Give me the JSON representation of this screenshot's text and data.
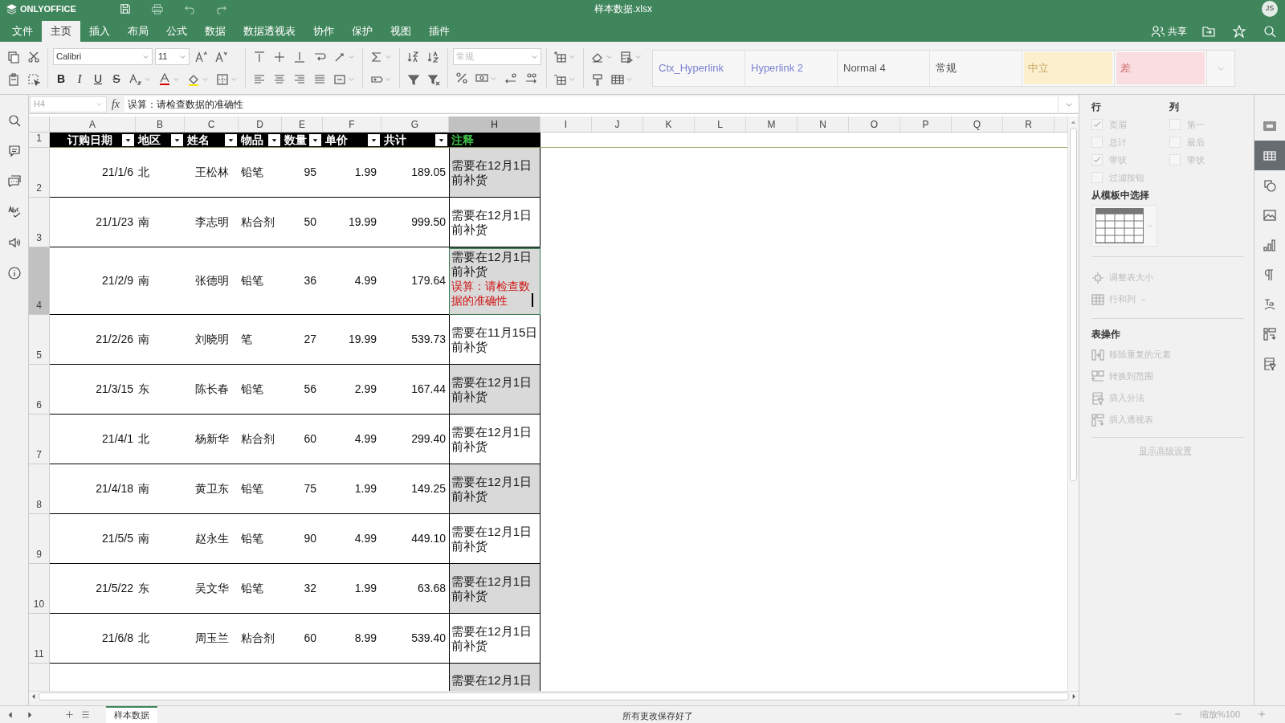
{
  "app": {
    "logo": "ONLYOFFICE",
    "title": "样本数据.xlsx",
    "avatar": "JS",
    "share": "共享"
  },
  "menu": [
    {
      "label": "文件",
      "selected": false
    },
    {
      "label": "主页",
      "selected": true
    },
    {
      "label": "插入",
      "selected": false
    },
    {
      "label": "布局",
      "selected": false
    },
    {
      "label": "公式",
      "selected": false
    },
    {
      "label": "数据",
      "selected": false
    },
    {
      "label": "数据透视表",
      "selected": false
    },
    {
      "label": "协作",
      "selected": false
    },
    {
      "label": "保护",
      "selected": false
    },
    {
      "label": "视图",
      "selected": false
    },
    {
      "label": "插件",
      "selected": false
    }
  ],
  "toolbar": {
    "font": "Calibri",
    "size": "11",
    "number_format": "常规",
    "bold": "B",
    "italic": "I",
    "underline": "U",
    "strike": "S"
  },
  "styles": [
    {
      "label": "Ctx_Hyperlink",
      "kind": "link"
    },
    {
      "label": "Hyperlink 2",
      "kind": "link"
    },
    {
      "label": "Normal 4",
      "kind": "normal"
    },
    {
      "label": "常规",
      "kind": "normal"
    },
    {
      "label": "中立",
      "kind": "neutral"
    },
    {
      "label": "差",
      "kind": "bad"
    }
  ],
  "formula_bar": {
    "cell": "H4",
    "fx": "fx",
    "formula": "误算：请检查数据的准确性"
  },
  "columns": [
    {
      "label": "A",
      "selected": false
    },
    {
      "label": "B",
      "selected": false
    },
    {
      "label": "C",
      "selected": false
    },
    {
      "label": "D",
      "selected": false
    },
    {
      "label": "E",
      "selected": false
    },
    {
      "label": "F",
      "selected": false
    },
    {
      "label": "G",
      "selected": false
    },
    {
      "label": "H",
      "selected": true
    },
    {
      "label": "I",
      "selected": false
    },
    {
      "label": "J",
      "selected": false
    },
    {
      "label": "K",
      "selected": false
    },
    {
      "label": "L",
      "selected": false
    },
    {
      "label": "M",
      "selected": false
    },
    {
      "label": "N",
      "selected": false
    },
    {
      "label": "O",
      "selected": false
    },
    {
      "label": "P",
      "selected": false
    },
    {
      "label": "Q",
      "selected": false
    },
    {
      "label": "R",
      "selected": false
    }
  ],
  "table": {
    "header_row": "1",
    "headers": [
      {
        "label": "订购日期",
        "filter": true
      },
      {
        "label": "地区",
        "filter": true
      },
      {
        "label": "姓名",
        "filter": true
      },
      {
        "label": "物品",
        "filter": true
      },
      {
        "label": "数量",
        "filter": true
      },
      {
        "label": "单价",
        "filter": true
      },
      {
        "label": "共计",
        "filter": true
      },
      {
        "label": "注释",
        "filter": false
      }
    ],
    "rows": [
      {
        "row": "2",
        "selected": false,
        "cells": [
          "21/1/6",
          "北",
          "王松林",
          "铅笔",
          "95",
          "1.99",
          "189.05"
        ],
        "note": "需要在12月1日前补货"
      },
      {
        "row": "3",
        "selected": false,
        "cells": [
          "21/1/23",
          "南",
          "李志明",
          "粘合剂",
          "50",
          "19.99",
          "999.50"
        ],
        "note": "需要在12月1日前补货"
      },
      {
        "row": "4",
        "selected": true,
        "cells": [
          "21/2/9",
          "南",
          "张德明",
          "铅笔",
          "36",
          "4.99",
          "179.64"
        ],
        "note": "需要在12月1日前补货",
        "error": "误算：请检查数据的准确性"
      },
      {
        "row": "5",
        "selected": false,
        "cells": [
          "21/2/26",
          "南",
          "刘晓明",
          "笔",
          "27",
          "19.99",
          "539.73"
        ],
        "note": "需要在11月15日前补货"
      },
      {
        "row": "6",
        "selected": false,
        "cells": [
          "21/3/15",
          "东",
          "陈长春",
          "铅笔",
          "56",
          "2.99",
          "167.44"
        ],
        "note": "需要在12月1日前补货"
      },
      {
        "row": "7",
        "selected": false,
        "cells": [
          "21/4/1",
          "北",
          "杨新华",
          "粘合剂",
          "60",
          "4.99",
          "299.40"
        ],
        "note": "需要在12月1日前补货"
      },
      {
        "row": "8",
        "selected": false,
        "cells": [
          "21/4/18",
          "南",
          "黄卫东",
          "铅笔",
          "75",
          "1.99",
          "149.25"
        ],
        "note": "需要在12月1日前补货"
      },
      {
        "row": "9",
        "selected": false,
        "cells": [
          "21/5/5",
          "南",
          "赵永生",
          "铅笔",
          "90",
          "4.99",
          "449.10"
        ],
        "note": "需要在12月1日前补货"
      },
      {
        "row": "10",
        "selected": false,
        "cells": [
          "21/5/22",
          "东",
          "吴文华",
          "铅笔",
          "32",
          "1.99",
          "63.68"
        ],
        "note": "需要在12月1日前补货"
      },
      {
        "row": "11",
        "selected": false,
        "cells": [
          "21/6/8",
          "北",
          "周玉兰",
          "粘合剂",
          "60",
          "8.99",
          "539.40"
        ],
        "note": "需要在12月1日前补货"
      },
      {
        "selected": false,
        "cells": [],
        "note": "需要在12月1日"
      }
    ]
  },
  "panel": {
    "rows_title": "行",
    "cols_title": "列",
    "row_options": [
      {
        "label": "页眉",
        "checked": true
      },
      {
        "label": "总计",
        "checked": false
      },
      {
        "label": "带状",
        "checked": true
      },
      {
        "label": "过滤按钮",
        "checked": false
      }
    ],
    "col_options": [
      {
        "label": "第一",
        "checked": false
      },
      {
        "label": "最后",
        "checked": false
      },
      {
        "label": "带状",
        "checked": false
      }
    ],
    "template_title": "从模板中选择",
    "resize": "调整表大小",
    "rows_cols": "行和列",
    "ops_title": "表操作",
    "ops": [
      "移除重复的元素",
      "转换到范围",
      "插入分法",
      "插入透视表"
    ],
    "advanced": "显示高级设置"
  },
  "sheet_tabs": [
    {
      "label": "样本数据",
      "selected": true
    }
  ],
  "status": "所有更改保存好了",
  "zoom": "缩放%100"
}
